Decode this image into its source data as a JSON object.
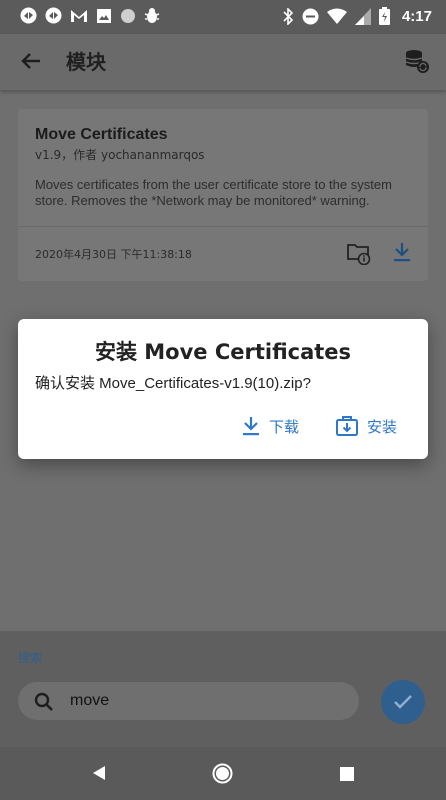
{
  "status_bar": {
    "time": "4:17",
    "left_icons": [
      "sync-icon",
      "sync-icon",
      "gmail-icon",
      "image-icon",
      "circle-icon",
      "bug-icon"
    ],
    "right_icons": [
      "bluetooth-icon",
      "do-not-disturb-icon",
      "wifi-icon",
      "signal-icon",
      "battery-icon"
    ]
  },
  "app_bar": {
    "title": "模块",
    "back_icon": "arrow-back-icon",
    "action_icon": "database-sync-icon"
  },
  "module_card": {
    "name": "Move Certificates",
    "version_author": "v1.9，作者 yochananmarqos",
    "description": "Moves certificates from the user certificate store to the system store. Removes the *Network may be monitored* warning.",
    "date": "2020年4月30日 下午11:38:18"
  },
  "dialog": {
    "title": "安装 Move Certificates",
    "message": "确认安装 Move_Certificates-v1.9(10).zip?",
    "download_label": "下载",
    "install_label": "安装"
  },
  "search": {
    "label": "搜索",
    "value": "move"
  },
  "colors": {
    "accent": "#2f78c9",
    "dim_accent": "#2e5f8e",
    "scrim_bg": "#6f6f6f"
  }
}
